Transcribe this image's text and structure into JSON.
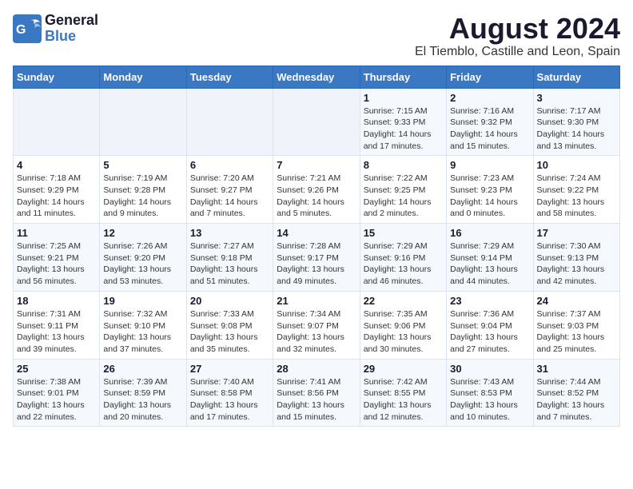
{
  "header": {
    "logo_text_general": "General",
    "logo_text_blue": "Blue",
    "title": "August 2024",
    "subtitle": "El Tiemblo, Castille and Leon, Spain"
  },
  "calendar": {
    "days_of_week": [
      "Sunday",
      "Monday",
      "Tuesday",
      "Wednesday",
      "Thursday",
      "Friday",
      "Saturday"
    ],
    "weeks": [
      [
        {
          "day": "",
          "info": ""
        },
        {
          "day": "",
          "info": ""
        },
        {
          "day": "",
          "info": ""
        },
        {
          "day": "",
          "info": ""
        },
        {
          "day": "1",
          "info": "Sunrise: 7:15 AM\nSunset: 9:33 PM\nDaylight: 14 hours and 17 minutes."
        },
        {
          "day": "2",
          "info": "Sunrise: 7:16 AM\nSunset: 9:32 PM\nDaylight: 14 hours and 15 minutes."
        },
        {
          "day": "3",
          "info": "Sunrise: 7:17 AM\nSunset: 9:30 PM\nDaylight: 14 hours and 13 minutes."
        }
      ],
      [
        {
          "day": "4",
          "info": "Sunrise: 7:18 AM\nSunset: 9:29 PM\nDaylight: 14 hours and 11 minutes."
        },
        {
          "day": "5",
          "info": "Sunrise: 7:19 AM\nSunset: 9:28 PM\nDaylight: 14 hours and 9 minutes."
        },
        {
          "day": "6",
          "info": "Sunrise: 7:20 AM\nSunset: 9:27 PM\nDaylight: 14 hours and 7 minutes."
        },
        {
          "day": "7",
          "info": "Sunrise: 7:21 AM\nSunset: 9:26 PM\nDaylight: 14 hours and 5 minutes."
        },
        {
          "day": "8",
          "info": "Sunrise: 7:22 AM\nSunset: 9:25 PM\nDaylight: 14 hours and 2 minutes."
        },
        {
          "day": "9",
          "info": "Sunrise: 7:23 AM\nSunset: 9:23 PM\nDaylight: 14 hours and 0 minutes."
        },
        {
          "day": "10",
          "info": "Sunrise: 7:24 AM\nSunset: 9:22 PM\nDaylight: 13 hours and 58 minutes."
        }
      ],
      [
        {
          "day": "11",
          "info": "Sunrise: 7:25 AM\nSunset: 9:21 PM\nDaylight: 13 hours and 56 minutes."
        },
        {
          "day": "12",
          "info": "Sunrise: 7:26 AM\nSunset: 9:20 PM\nDaylight: 13 hours and 53 minutes."
        },
        {
          "day": "13",
          "info": "Sunrise: 7:27 AM\nSunset: 9:18 PM\nDaylight: 13 hours and 51 minutes."
        },
        {
          "day": "14",
          "info": "Sunrise: 7:28 AM\nSunset: 9:17 PM\nDaylight: 13 hours and 49 minutes."
        },
        {
          "day": "15",
          "info": "Sunrise: 7:29 AM\nSunset: 9:16 PM\nDaylight: 13 hours and 46 minutes."
        },
        {
          "day": "16",
          "info": "Sunrise: 7:29 AM\nSunset: 9:14 PM\nDaylight: 13 hours and 44 minutes."
        },
        {
          "day": "17",
          "info": "Sunrise: 7:30 AM\nSunset: 9:13 PM\nDaylight: 13 hours and 42 minutes."
        }
      ],
      [
        {
          "day": "18",
          "info": "Sunrise: 7:31 AM\nSunset: 9:11 PM\nDaylight: 13 hours and 39 minutes."
        },
        {
          "day": "19",
          "info": "Sunrise: 7:32 AM\nSunset: 9:10 PM\nDaylight: 13 hours and 37 minutes."
        },
        {
          "day": "20",
          "info": "Sunrise: 7:33 AM\nSunset: 9:08 PM\nDaylight: 13 hours and 35 minutes."
        },
        {
          "day": "21",
          "info": "Sunrise: 7:34 AM\nSunset: 9:07 PM\nDaylight: 13 hours and 32 minutes."
        },
        {
          "day": "22",
          "info": "Sunrise: 7:35 AM\nSunset: 9:06 PM\nDaylight: 13 hours and 30 minutes."
        },
        {
          "day": "23",
          "info": "Sunrise: 7:36 AM\nSunset: 9:04 PM\nDaylight: 13 hours and 27 minutes."
        },
        {
          "day": "24",
          "info": "Sunrise: 7:37 AM\nSunset: 9:03 PM\nDaylight: 13 hours and 25 minutes."
        }
      ],
      [
        {
          "day": "25",
          "info": "Sunrise: 7:38 AM\nSunset: 9:01 PM\nDaylight: 13 hours and 22 minutes."
        },
        {
          "day": "26",
          "info": "Sunrise: 7:39 AM\nSunset: 8:59 PM\nDaylight: 13 hours and 20 minutes."
        },
        {
          "day": "27",
          "info": "Sunrise: 7:40 AM\nSunset: 8:58 PM\nDaylight: 13 hours and 17 minutes."
        },
        {
          "day": "28",
          "info": "Sunrise: 7:41 AM\nSunset: 8:56 PM\nDaylight: 13 hours and 15 minutes."
        },
        {
          "day": "29",
          "info": "Sunrise: 7:42 AM\nSunset: 8:55 PM\nDaylight: 13 hours and 12 minutes."
        },
        {
          "day": "30",
          "info": "Sunrise: 7:43 AM\nSunset: 8:53 PM\nDaylight: 13 hours and 10 minutes."
        },
        {
          "day": "31",
          "info": "Sunrise: 7:44 AM\nSunset: 8:52 PM\nDaylight: 13 hours and 7 minutes."
        }
      ]
    ]
  }
}
